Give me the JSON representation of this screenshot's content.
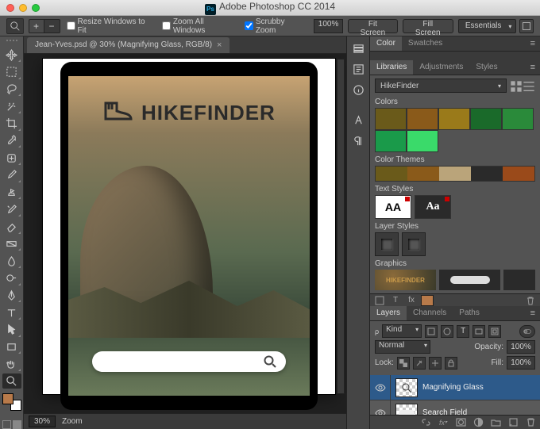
{
  "app": {
    "title": "Adobe Photoshop CC 2014"
  },
  "optionsBar": {
    "resizeWindows": "Resize Windows to Fit",
    "zoomAll": "Zoom All Windows",
    "scrubby": "Scrubby Zoom",
    "zoomValue": "100%",
    "fitScreen": "Fit Screen",
    "fillScreen": "Fill Screen",
    "workspace": "Essentials"
  },
  "document": {
    "tabTitle": "Jean-Yves.psd @ 30% (Magnifying Glass, RGB/8)",
    "brand": "HIKEFINDER",
    "zoomStatus": "30%",
    "toolStatus": "Zoom"
  },
  "panels": {
    "colorTab": "Color",
    "swatchesTab": "Swatches",
    "librariesTab": "Libraries",
    "adjustmentsTab": "Adjustments",
    "stylesTab": "Styles",
    "libraryName": "HikeFinder",
    "sections": {
      "colors": "Colors",
      "colorThemes": "Color Themes",
      "textStyles": "Text Styles",
      "layerStyles": "Layer Styles",
      "graphics": "Graphics"
    },
    "colorSwatches": [
      "#6a5a1a",
      "#8a5a1a",
      "#9a7a1a",
      "#1a6a2a",
      "#2a8a3a",
      "#1a9a4a",
      "#3ada6a"
    ],
    "themeColors": [
      "#6a5a1a",
      "#8a5a1a",
      "#baa47a",
      "#2a2a2a",
      "#9a4a1a"
    ],
    "textStyleLabels": [
      "AA",
      "Aa"
    ],
    "graphicsBrand": "HIKEFINDER"
  },
  "layersPanel": {
    "layersTab": "Layers",
    "channelsTab": "Channels",
    "pathsTab": "Paths",
    "filterLabel": "Kind",
    "blendMode": "Normal",
    "opacityLabel": "Opacity:",
    "opacityValue": "100%",
    "lockLabel": "Lock:",
    "fillLabel": "Fill:",
    "fillValue": "100%",
    "layers": [
      {
        "name": "Magnifying Glass",
        "selected": true
      },
      {
        "name": "Search Field",
        "selected": false
      }
    ]
  }
}
